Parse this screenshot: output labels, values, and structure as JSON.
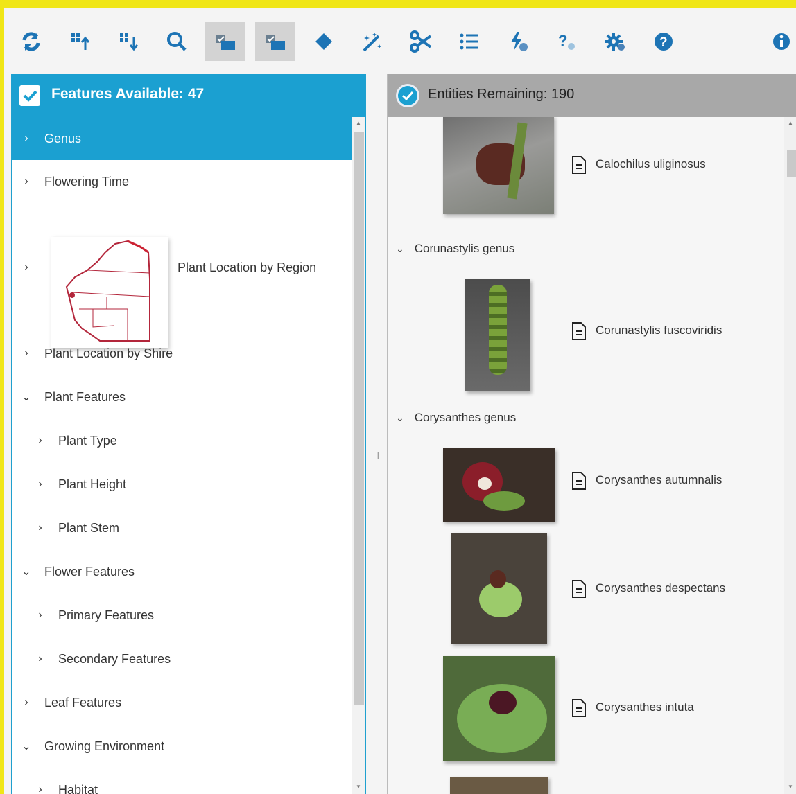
{
  "toolbar": {
    "buttons": [
      {
        "name": "refresh-icon",
        "active": false
      },
      {
        "name": "sort-up-icon",
        "active": false
      },
      {
        "name": "sort-down-icon",
        "active": false
      },
      {
        "name": "search-icon",
        "active": false
      },
      {
        "name": "image-check-icon",
        "active": true
      },
      {
        "name": "image-check-alt-icon",
        "active": true
      },
      {
        "name": "diamond-icon",
        "active": false
      },
      {
        "name": "magic-wand-icon",
        "active": false
      },
      {
        "name": "scissors-icon",
        "active": false
      },
      {
        "name": "list-icon",
        "active": false
      },
      {
        "name": "lightning-check-icon",
        "active": false
      },
      {
        "name": "question-small-icon",
        "active": false
      },
      {
        "name": "gear-icon",
        "active": false
      },
      {
        "name": "help-icon",
        "active": false
      },
      {
        "name": "info-icon",
        "active": false
      }
    ]
  },
  "features": {
    "title": "Features Available: 47",
    "items": [
      {
        "label": "Genus",
        "arrow": "›",
        "level": 0,
        "selected": true
      },
      {
        "label": "Flowering Time",
        "arrow": "›",
        "level": 0
      },
      {
        "label": "Plant Location by Region",
        "arrow": "›",
        "level": 0,
        "has_map": true
      },
      {
        "label": "Plant Location by Shire",
        "arrow": "›",
        "level": 0
      },
      {
        "label": "Plant Features",
        "arrow": "⌄",
        "level": 0
      },
      {
        "label": "Plant Type",
        "arrow": "›",
        "level": 1
      },
      {
        "label": "Plant Height",
        "arrow": "›",
        "level": 1
      },
      {
        "label": "Plant Stem",
        "arrow": "›",
        "level": 1
      },
      {
        "label": "Flower Features",
        "arrow": "⌄",
        "level": 0
      },
      {
        "label": "Primary Features",
        "arrow": "›",
        "level": 1
      },
      {
        "label": "Secondary Features",
        "arrow": "›",
        "level": 1
      },
      {
        "label": "Leaf Features",
        "arrow": "›",
        "level": 0
      },
      {
        "label": "Growing Environment",
        "arrow": "⌄",
        "level": 0
      },
      {
        "label": "Habitat",
        "arrow": "›",
        "level": 1
      }
    ]
  },
  "entities": {
    "title": "Entities Remaining: 190",
    "groups": [
      {
        "label": "Corunastylis genus",
        "arrow": "⌄"
      },
      {
        "label": "Corysanthes genus",
        "arrow": "⌄"
      }
    ],
    "items": [
      {
        "name": "Calochilus uliginosus"
      },
      {
        "name": "Corunastylis fuscoviridis"
      },
      {
        "name": "Corysanthes autumnalis"
      },
      {
        "name": "Corysanthes despectans"
      },
      {
        "name": "Corysanthes intuta"
      }
    ]
  },
  "colors": {
    "accent": "#1ba0d1",
    "frame": "#f0e617",
    "header_grey": "#a8a8a8"
  }
}
